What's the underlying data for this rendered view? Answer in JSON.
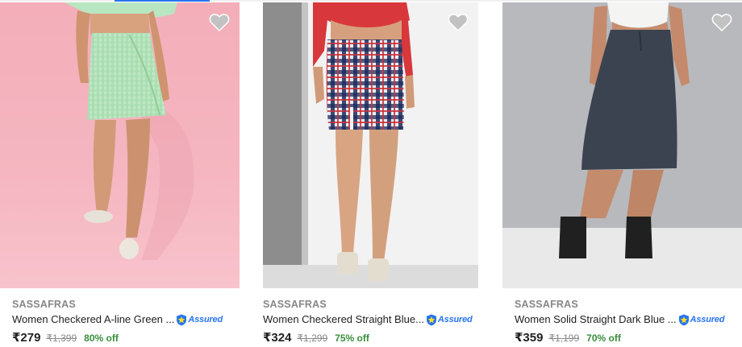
{
  "products": [
    {
      "brand": "SASSAFRAS",
      "title": "Women Checkered A-line Green ...",
      "assured_label": "Assured",
      "price": "₹279",
      "mrp": "₹1,399",
      "discount": "80% off",
      "wishlist_icon": "heart-icon"
    },
    {
      "brand": "SASSAFRAS",
      "title": "Women Checkered Straight Blue...",
      "assured_label": "Assured",
      "price": "₹324",
      "mrp": "₹1,299",
      "discount": "75% off",
      "wishlist_icon": "heart-icon"
    },
    {
      "brand": "SASSAFRAS",
      "title": "Women Solid Straight Dark Blue ...",
      "assured_label": "Assured",
      "price": "₹359",
      "mrp": "₹1,199",
      "discount": "70% off",
      "wishlist_icon": "heart-icon"
    }
  ],
  "colors": {
    "brand_text": "#878787",
    "price_text": "#212121",
    "discount_text": "#388e3c",
    "assured_text": "#2874f0",
    "wishlist_heart": "#c2c2c2"
  }
}
